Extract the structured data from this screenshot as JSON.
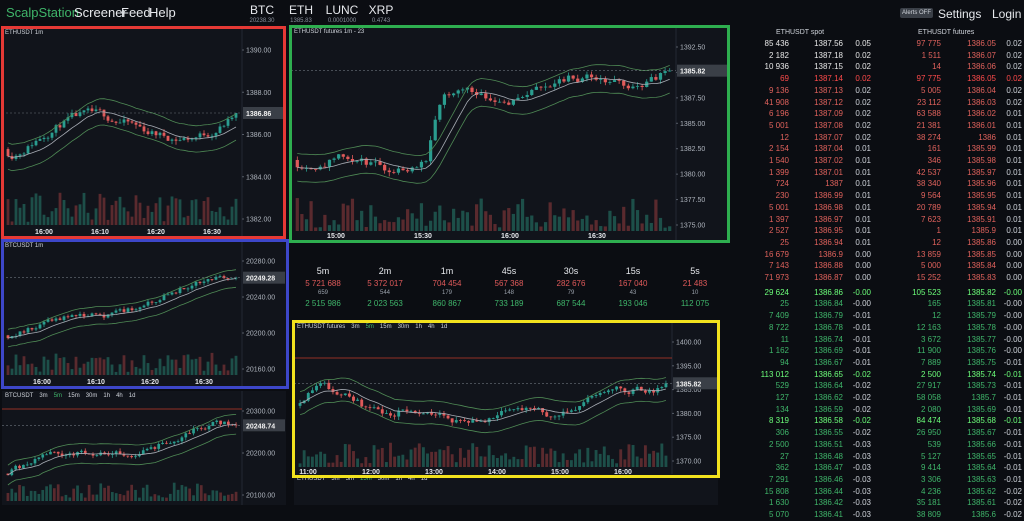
{
  "brand": "ScalpStation",
  "nav": [
    "Screener",
    "Feed",
    "Help"
  ],
  "tickers": [
    {
      "symbol": "BTC",
      "price": "20238.30"
    },
    {
      "symbol": "ETH",
      "price": "1385.83"
    },
    {
      "symbol": "LUNC",
      "price": "0.0001000"
    },
    {
      "symbol": "XRP",
      "price": "0.4743"
    }
  ],
  "alerts_label": "Alerts OFF",
  "settings_label": "Settings",
  "login_label": "Login",
  "timeframes": [
    "3m",
    "5m",
    "15m",
    "30m",
    "1h",
    "4h",
    "1d"
  ],
  "charts": {
    "eth1m": {
      "title": "ETHUSDT 1m",
      "price_label": "1386.86",
      "y_ticks": [
        "1390.00",
        "1388.00",
        "1386.00",
        "1384.00",
        "1382.00"
      ],
      "x_ticks": [
        "16:00",
        "16:10",
        "16:20",
        "16:30"
      ]
    },
    "ethfut1m": {
      "title": "ETHUSDT futures 1m - 23",
      "price_label": "1385.82",
      "y_ticks": [
        "1392.50",
        "1390.00",
        "1387.50",
        "1385.00",
        "1382.50",
        "1380.00",
        "1377.50",
        "1375.00"
      ],
      "x_ticks": [
        "15:00",
        "15:30",
        "16:00",
        "16:30"
      ]
    },
    "btc1m": {
      "title": "BTCUSDT 1m",
      "price_label": "20249.28",
      "y_ticks": [
        "20280.00",
        "20240.00",
        "20200.00",
        "20160.00"
      ],
      "x_ticks": [
        "16:00",
        "16:10",
        "16:20",
        "16:30"
      ]
    },
    "btcmulti": {
      "title": "BTCUSDT",
      "active_tf": "5m",
      "price_label": "20248.74",
      "y_ticks": [
        "20300.00",
        "20200.00",
        "20100.00"
      ]
    },
    "ethfutmulti": {
      "title": "ETHUSDT futures",
      "active_tf": "5m",
      "price_label": "1385.82",
      "y_ticks": [
        "1400.00",
        "1395.00",
        "1385.00",
        "1380.00",
        "1375.00",
        "1370.00"
      ],
      "x_ticks": [
        "11:00",
        "12:00",
        "13:00",
        "14:00",
        "15:00",
        "16:00"
      ]
    },
    "ethmulti": {
      "title": "ETHUSDT",
      "active_tf": "15m"
    }
  },
  "stats": [
    {
      "label": "5m",
      "red": "5 721 688",
      "mid": "659",
      "green": "2 515 986"
    },
    {
      "label": "2m",
      "red": "5 372 017",
      "mid": "544",
      "green": "2 023 563"
    },
    {
      "label": "1m",
      "red": "704 454",
      "mid": "179",
      "green": "860 867"
    },
    {
      "label": "45s",
      "red": "567 368",
      "mid": "148",
      "green": "733 189"
    },
    {
      "label": "30s",
      "red": "282 676",
      "mid": "79",
      "green": "687 544"
    },
    {
      "label": "15s",
      "red": "167 040",
      "mid": "43",
      "green": "193 046"
    },
    {
      "label": "5s",
      "red": "21 483",
      "mid": "10",
      "green": "112 075"
    }
  ],
  "book": {
    "spot_title": "ETHUSDT spot",
    "futures_title": "ETHUSDT futures",
    "asks": [
      [
        "85 436",
        "1387.56",
        "0.05",
        "97 775",
        "1386.05",
        "0.02"
      ],
      [
        "2 182",
        "1387.18",
        "0.02",
        "1 511",
        "1386.07",
        "0.02"
      ],
      [
        "10 936",
        "1387.15",
        "0.02",
        "14",
        "1386.06",
        "0.02"
      ],
      [
        "69",
        "1387.14",
        "0.02",
        "97 775",
        "1386.05",
        "0.02"
      ],
      [
        "9 136",
        "1387.13",
        "0.02",
        "5 005",
        "1386.04",
        "0.02"
      ],
      [
        "41 908",
        "1387.12",
        "0.02",
        "23 112",
        "1386.03",
        "0.02"
      ],
      [
        "6 196",
        "1387.09",
        "0.02",
        "63 588",
        "1386.02",
        "0.01"
      ],
      [
        "5 001",
        "1387.08",
        "0.02",
        "21 381",
        "1386.01",
        "0.01"
      ],
      [
        "12",
        "1387.07",
        "0.02",
        "38 274",
        "1386",
        "0.01"
      ],
      [
        "2 154",
        "1387.04",
        "0.01",
        "161",
        "1385.99",
        "0.01"
      ],
      [
        "1 540",
        "1387.02",
        "0.01",
        "346",
        "1385.98",
        "0.01"
      ],
      [
        "1 399",
        "1387.01",
        "0.01",
        "42 537",
        "1385.97",
        "0.01"
      ],
      [
        "724",
        "1387",
        "0.01",
        "38 340",
        "1385.96",
        "0.01"
      ],
      [
        "230",
        "1386.99",
        "0.01",
        "9 564",
        "1385.95",
        "0.01"
      ],
      [
        "5 001",
        "1386.98",
        "0.01",
        "20 789",
        "1385.94",
        "0.01"
      ],
      [
        "1 397",
        "1386.97",
        "0.01",
        "7 623",
        "1385.91",
        "0.01"
      ],
      [
        "2 527",
        "1386.95",
        "0.01",
        "1",
        "1385.9",
        "0.01"
      ],
      [
        "25",
        "1386.94",
        "0.01",
        "12",
        "1385.86",
        "0.00"
      ],
      [
        "16 679",
        "1386.9",
        "0.00",
        "13 859",
        "1385.85",
        "0.00"
      ],
      [
        "7 143",
        "1386.88",
        "0.00",
        "5 000",
        "1385.84",
        "0.00"
      ],
      [
        "71 973",
        "1386.87",
        "0.00",
        "15 252",
        "1385.83",
        "0.00"
      ]
    ],
    "bids": [
      [
        "29 624",
        "1386.86",
        "-0.00",
        "105 523",
        "1385.82",
        "-0.00"
      ],
      [
        "25",
        "1386.84",
        "-0.00",
        "165",
        "1385.81",
        "-0.00"
      ],
      [
        "7 409",
        "1386.79",
        "-0.01",
        "12",
        "1385.79",
        "-0.00"
      ],
      [
        "8 722",
        "1386.78",
        "-0.01",
        "12 163",
        "1385.78",
        "-0.00"
      ],
      [
        "11",
        "1386.74",
        "-0.01",
        "3 672",
        "1385.77",
        "-0.00"
      ],
      [
        "1 162",
        "1386.69",
        "-0.01",
        "11 900",
        "1385.76",
        "-0.00"
      ],
      [
        "94",
        "1386.67",
        "-0.01",
        "7 889",
        "1385.75",
        "-0.01"
      ],
      [
        "113 012",
        "1386.65",
        "-0.02",
        "2 500",
        "1385.74",
        "-0.01"
      ],
      [
        "529",
        "1386.64",
        "-0.02",
        "27 917",
        "1385.73",
        "-0.01"
      ],
      [
        "127",
        "1386.62",
        "-0.02",
        "58 058",
        "1385.7",
        "-0.01"
      ],
      [
        "134",
        "1386.59",
        "-0.02",
        "2 080",
        "1385.69",
        "-0.01"
      ],
      [
        "8 319",
        "1386.58",
        "-0.02",
        "84 474",
        "1385.68",
        "-0.01"
      ],
      [
        "306",
        "1386.55",
        "-0.02",
        "26 950",
        "1385.67",
        "-0.01"
      ],
      [
        "2 500",
        "1386.51",
        "-0.03",
        "539",
        "1385.66",
        "-0.01"
      ],
      [
        "27",
        "1386.48",
        "-0.03",
        "5 127",
        "1385.65",
        "-0.01"
      ],
      [
        "362",
        "1386.47",
        "-0.03",
        "9 414",
        "1385.64",
        "-0.01"
      ],
      [
        "7 291",
        "1386.46",
        "-0.03",
        "3 306",
        "1385.63",
        "-0.01"
      ],
      [
        "15 808",
        "1386.44",
        "-0.03",
        "4 236",
        "1385.62",
        "-0.02"
      ],
      [
        "1 630",
        "1386.42",
        "-0.03",
        "35 181",
        "1385.61",
        "-0.02"
      ],
      [
        "5 070",
        "1386.41",
        "-0.03",
        "38 809",
        "1385.6",
        "-0.02"
      ]
    ]
  },
  "colors": {
    "up": "#3fb56a",
    "down": "#e05a5a",
    "highlight_red": "#e53935",
    "highlight_green": "#2eae4f",
    "highlight_blue": "#3d47c9",
    "highlight_yellow": "#f2e21e"
  }
}
